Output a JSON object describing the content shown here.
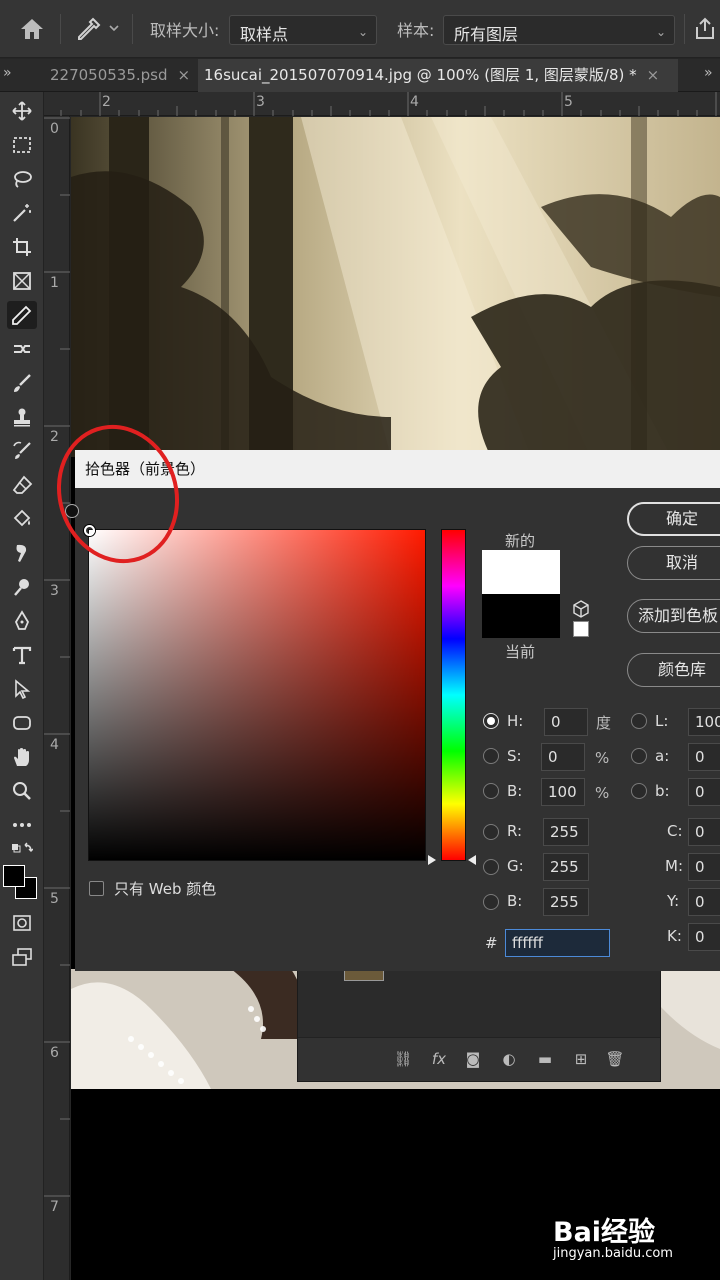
{
  "options_bar": {
    "sample_size_label": "取样大小:",
    "sample_size_value": "取样点",
    "sample_label": "样本:",
    "sample_value": "所有图层"
  },
  "tabs": {
    "overflow_left": "»",
    "inactive_tab": "227050535.psd",
    "active_tab": "16sucai_201507070914.jpg @ 100% (图层 1, 图层蒙版/8) *",
    "close_symbol": "×",
    "overflow_right": "»"
  },
  "rulers": {
    "top": [
      "2",
      "3",
      "4",
      "5"
    ],
    "left": [
      "0",
      "1",
      "2",
      "3",
      "4",
      "5",
      "6",
      "7"
    ]
  },
  "color_picker": {
    "title": "拾色器（前景色）",
    "new_label": "新的",
    "current_label": "当前",
    "buttons": {
      "ok": "确定",
      "cancel": "取消",
      "add_to_swatches": "添加到色板",
      "color_libraries": "颜色库"
    },
    "web_only_label": "只有 Web 颜色",
    "web_only_checked": false,
    "fields": {
      "H": {
        "label": "H:",
        "value": "0",
        "unit": "度"
      },
      "S": {
        "label": "S:",
        "value": "0",
        "unit": "%"
      },
      "B": {
        "label": "B:",
        "value": "100",
        "unit": "%"
      },
      "R": {
        "label": "R:",
        "value": "255"
      },
      "G": {
        "label": "G:",
        "value": "255"
      },
      "Bb": {
        "label": "B:",
        "value": "255"
      },
      "L": {
        "label": "L:",
        "value": "100"
      },
      "a": {
        "label": "a:",
        "value": "0"
      },
      "b": {
        "label": "b:",
        "value": "0"
      },
      "C": {
        "label": "C:",
        "value": "0"
      },
      "M": {
        "label": "M:",
        "value": "0"
      },
      "Y": {
        "label": "Y:",
        "value": "0"
      },
      "K": {
        "label": "K:",
        "value": "0"
      }
    },
    "selected_mode": "H",
    "hex_label": "#",
    "hex_value": "ffffff",
    "new_color": "#ffffff",
    "current_color": "#000000"
  },
  "watermark": {
    "logo": "Bai经验",
    "url": "jingyan.baidu.com"
  },
  "colors": {
    "annotation": "#e02020",
    "accent": "#4c8ad8"
  }
}
